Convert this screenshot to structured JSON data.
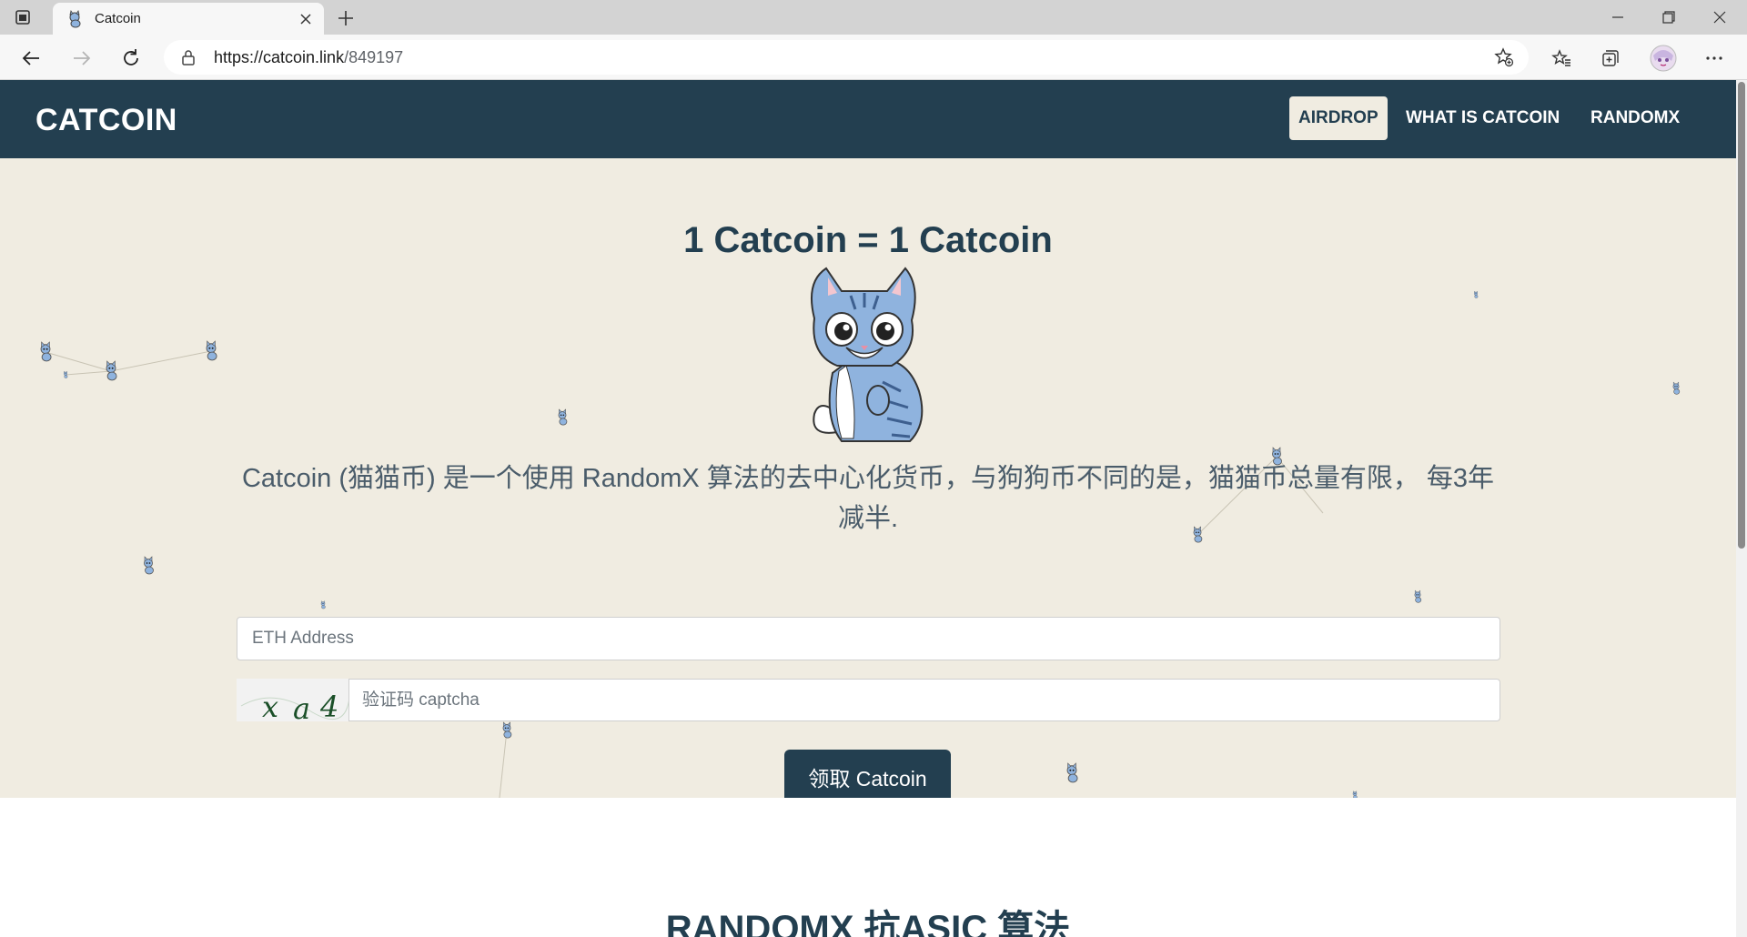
{
  "browser": {
    "tab_title": "Catcoin",
    "url_host": "https://catcoin.link",
    "url_path": "/849197",
    "icons": {
      "tab_actions": "tab-actions-icon",
      "close_tab": "close-icon",
      "new_tab": "plus-icon",
      "back": "arrow-left-icon",
      "forward": "arrow-right-icon",
      "refresh": "refresh-icon",
      "lock": "lock-icon",
      "add_favorite": "star-plus-icon",
      "favorites": "favorites-icon",
      "collections": "collections-icon",
      "profile": "avatar",
      "menu": "more-icon"
    }
  },
  "navbar": {
    "brand": "CATCOIN",
    "links": [
      {
        "label": "AIRDROP",
        "active": true
      },
      {
        "label": "WHAT IS CATCOIN",
        "active": false
      },
      {
        "label": "RANDOMX",
        "active": false
      }
    ]
  },
  "hero": {
    "title": "1 Catcoin = 1 Catcoin",
    "description": "Catcoin (猫猫币) 是一个使用 RandomX 算法的去中心化货币，与狗狗币不同的是，猫猫币总量有限， 每3年减半.",
    "eth_placeholder": "ETH Address",
    "captcha_chars": [
      "x",
      "a",
      "4"
    ],
    "captcha_placeholder": "验证码 captcha",
    "claim_label": "领取 Catcoin"
  },
  "section2": {
    "title": "RANDOMX 抗ASIC 算法"
  },
  "colors": {
    "navy": "#233f50",
    "cream": "#f0ece1",
    "white": "#ffffff"
  }
}
